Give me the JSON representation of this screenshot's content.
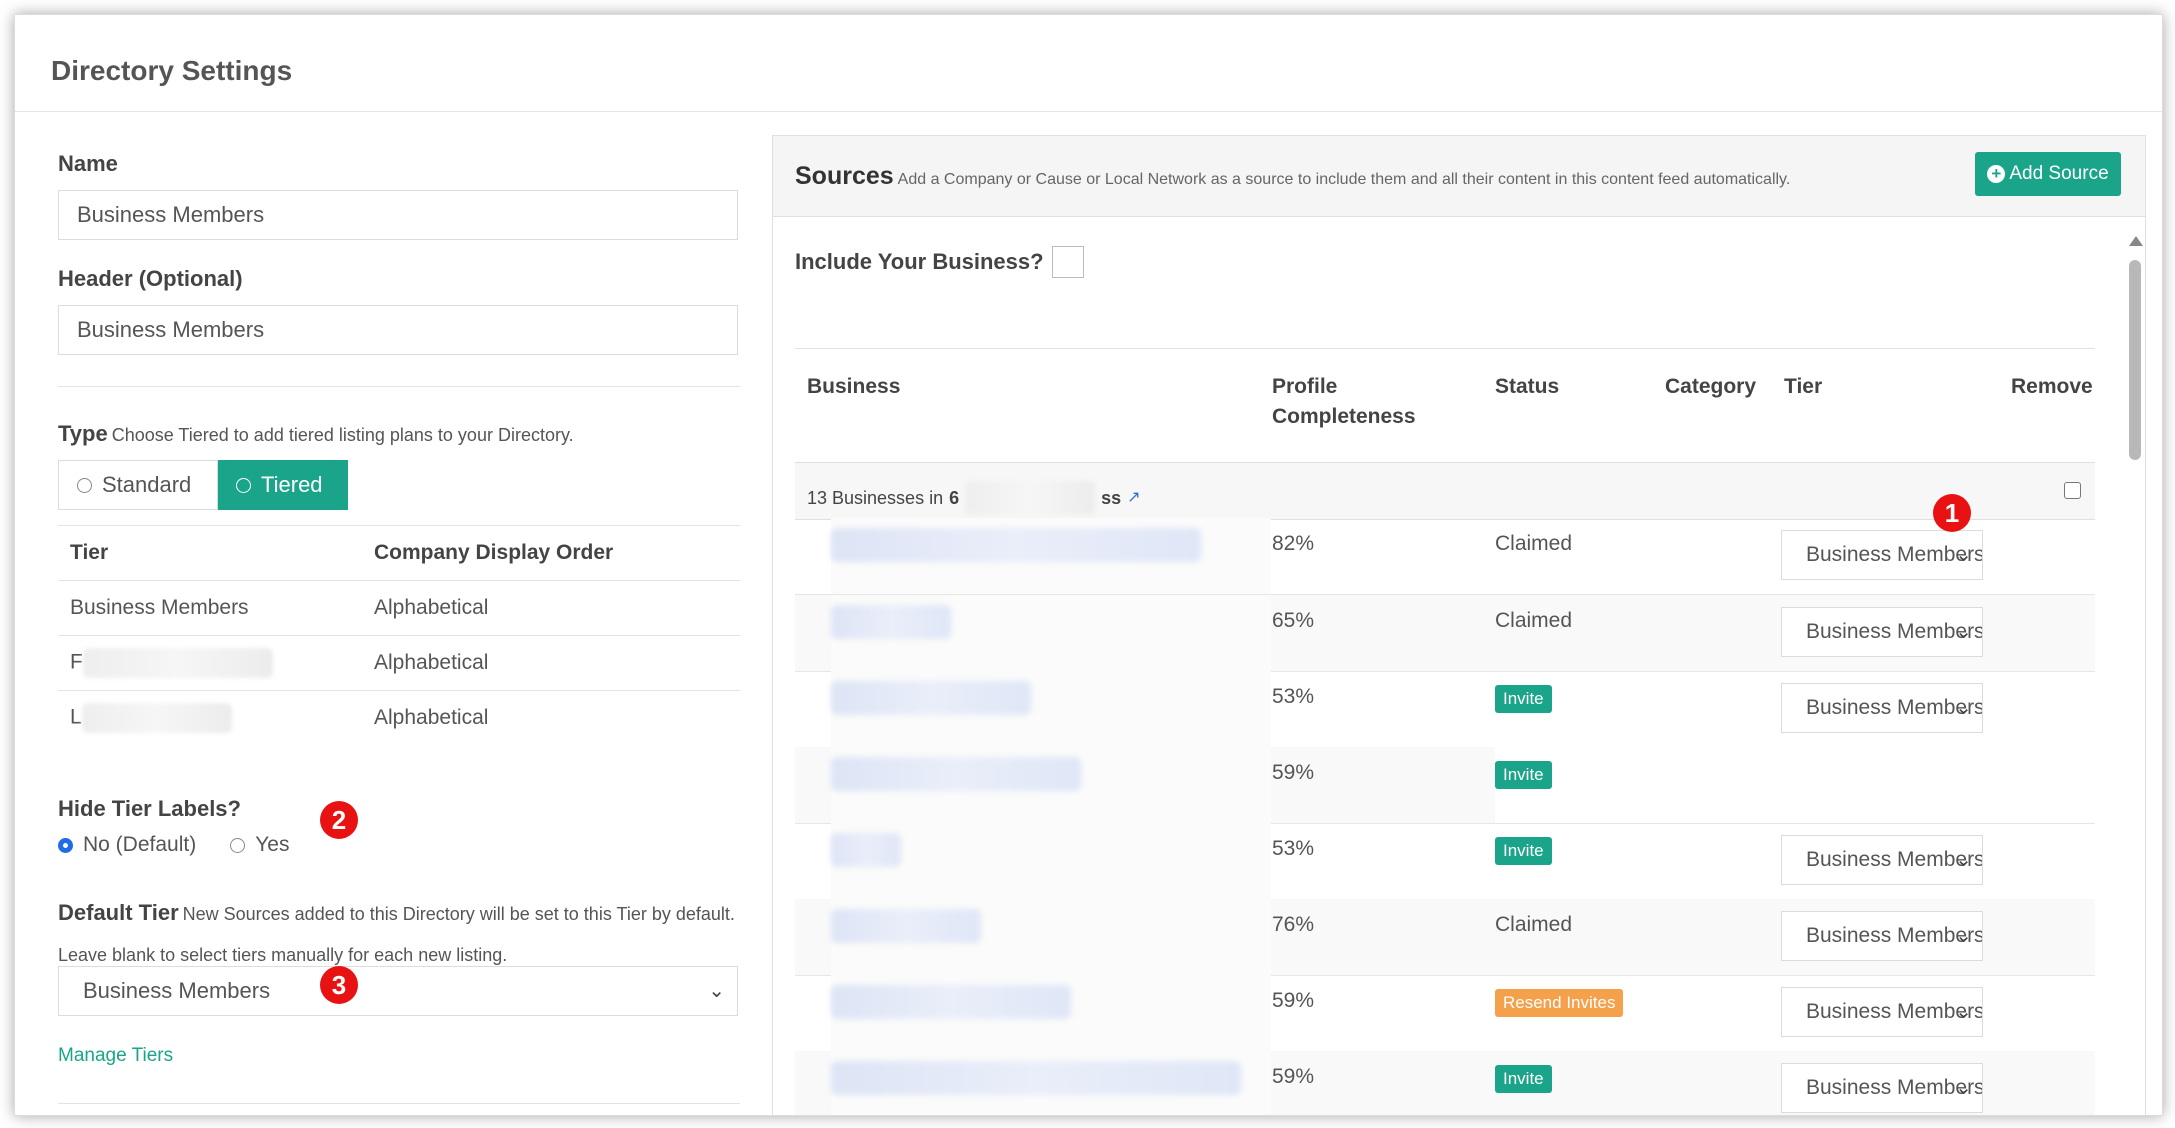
{
  "page": {
    "title": "Directory Settings"
  },
  "form": {
    "name_label": "Name",
    "name_value": "Business Members",
    "header_label": "Header (Optional)",
    "header_value": "Business Members",
    "type_label": "Type",
    "type_hint": "Choose Tiered to add tiered listing plans to your Directory.",
    "type_options": {
      "standard": "Standard",
      "tiered": "Tiered"
    },
    "type_selected": "Tiered",
    "tier_table": {
      "headers": [
        "Tier",
        "Company Display Order"
      ],
      "rows": [
        {
          "tier": "Business Members",
          "order": "Alphabetical"
        },
        {
          "tier": "F",
          "order": "Alphabetical"
        },
        {
          "tier": "L",
          "order": "Alphabetical"
        }
      ]
    },
    "hide_labels_label": "Hide Tier Labels?",
    "hide_labels_options": {
      "no": "No (Default)",
      "yes": "Yes"
    },
    "hide_labels_selected": "No (Default)",
    "default_tier_label": "Default Tier",
    "default_tier_hint": "New Sources added to this Directory will be set to this Tier by default. Leave blank to select tiers manually for each new listing.",
    "default_tier_value": "Business Members",
    "manage_tiers_link": "Manage Tiers"
  },
  "badges": [
    "1",
    "2",
    "3"
  ],
  "sources": {
    "title": "Sources",
    "hint": "Add a Company or Cause or Local Network as a source to include them and all their content in this content feed automatically.",
    "add_button": "Add Source",
    "include_label": "Include Your Business?",
    "columns": [
      "Business",
      "Profile Completeness",
      "Status",
      "Category",
      "Tier",
      "Remove"
    ],
    "group": {
      "prefix": "13 Businesses in",
      "name_start": "6",
      "name_end": "ss"
    },
    "rows": [
      {
        "pct": "82%",
        "status": "Claimed",
        "status_kind": "text",
        "tier": "Business Members"
      },
      {
        "pct": "65%",
        "status": "Claimed",
        "status_kind": "text",
        "tier": "Business Members"
      },
      {
        "pct": "53%",
        "status": "Invite",
        "status_kind": "invite",
        "tier": "Business Members"
      },
      {
        "pct": "59%",
        "status": "Invite",
        "status_kind": "invite",
        "tier": ""
      },
      {
        "pct": "53%",
        "status": "Invite",
        "status_kind": "invite",
        "tier": "Business Members"
      },
      {
        "pct": "76%",
        "status": "Claimed",
        "status_kind": "text",
        "tier": "Business Members"
      },
      {
        "pct": "59%",
        "status": "Resend Invites",
        "status_kind": "resend",
        "tier": "Business Members"
      },
      {
        "pct": "59%",
        "status": "Invite",
        "status_kind": "invite",
        "tier": "Business Members"
      }
    ]
  },
  "colors": {
    "accent": "#1aa58a",
    "resend": "#f5a04b",
    "badge": "#e81212",
    "link": "#2a6fd6"
  }
}
